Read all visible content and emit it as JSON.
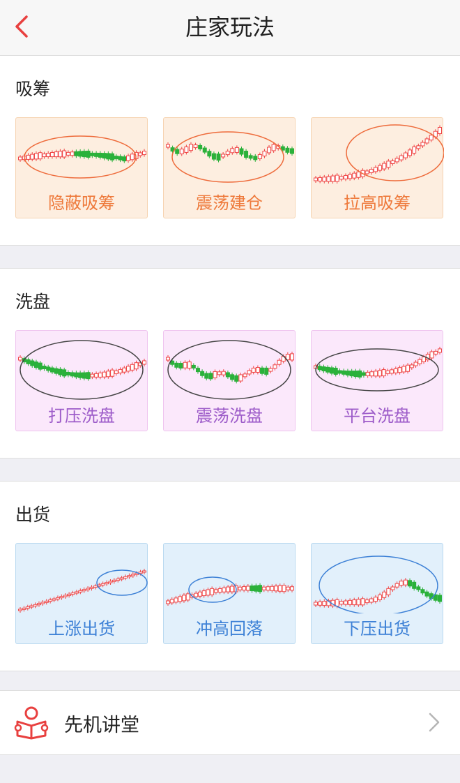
{
  "header": {
    "title": "庄家玩法"
  },
  "sections": [
    {
      "title": "吸筹",
      "cards": [
        {
          "label": "隐蔽吸筹"
        },
        {
          "label": "震荡建仓"
        },
        {
          "label": "拉高吸筹"
        }
      ]
    },
    {
      "title": "洗盘",
      "cards": [
        {
          "label": "打压洗盘"
        },
        {
          "label": "震荡洗盘"
        },
        {
          "label": "平台洗盘"
        }
      ]
    },
    {
      "title": "出货",
      "cards": [
        {
          "label": "上涨出货"
        },
        {
          "label": "冲高回落"
        },
        {
          "label": "下压出货"
        }
      ]
    }
  ],
  "lecture": {
    "label": "先机讲堂"
  },
  "colors": {
    "accent": "#e8403f",
    "up": "#ef4545",
    "down": "#2ab13a"
  },
  "icons": {
    "back": "chevron-left-icon",
    "lecture": "reading-person-icon",
    "forward": "chevron-right-icon"
  }
}
